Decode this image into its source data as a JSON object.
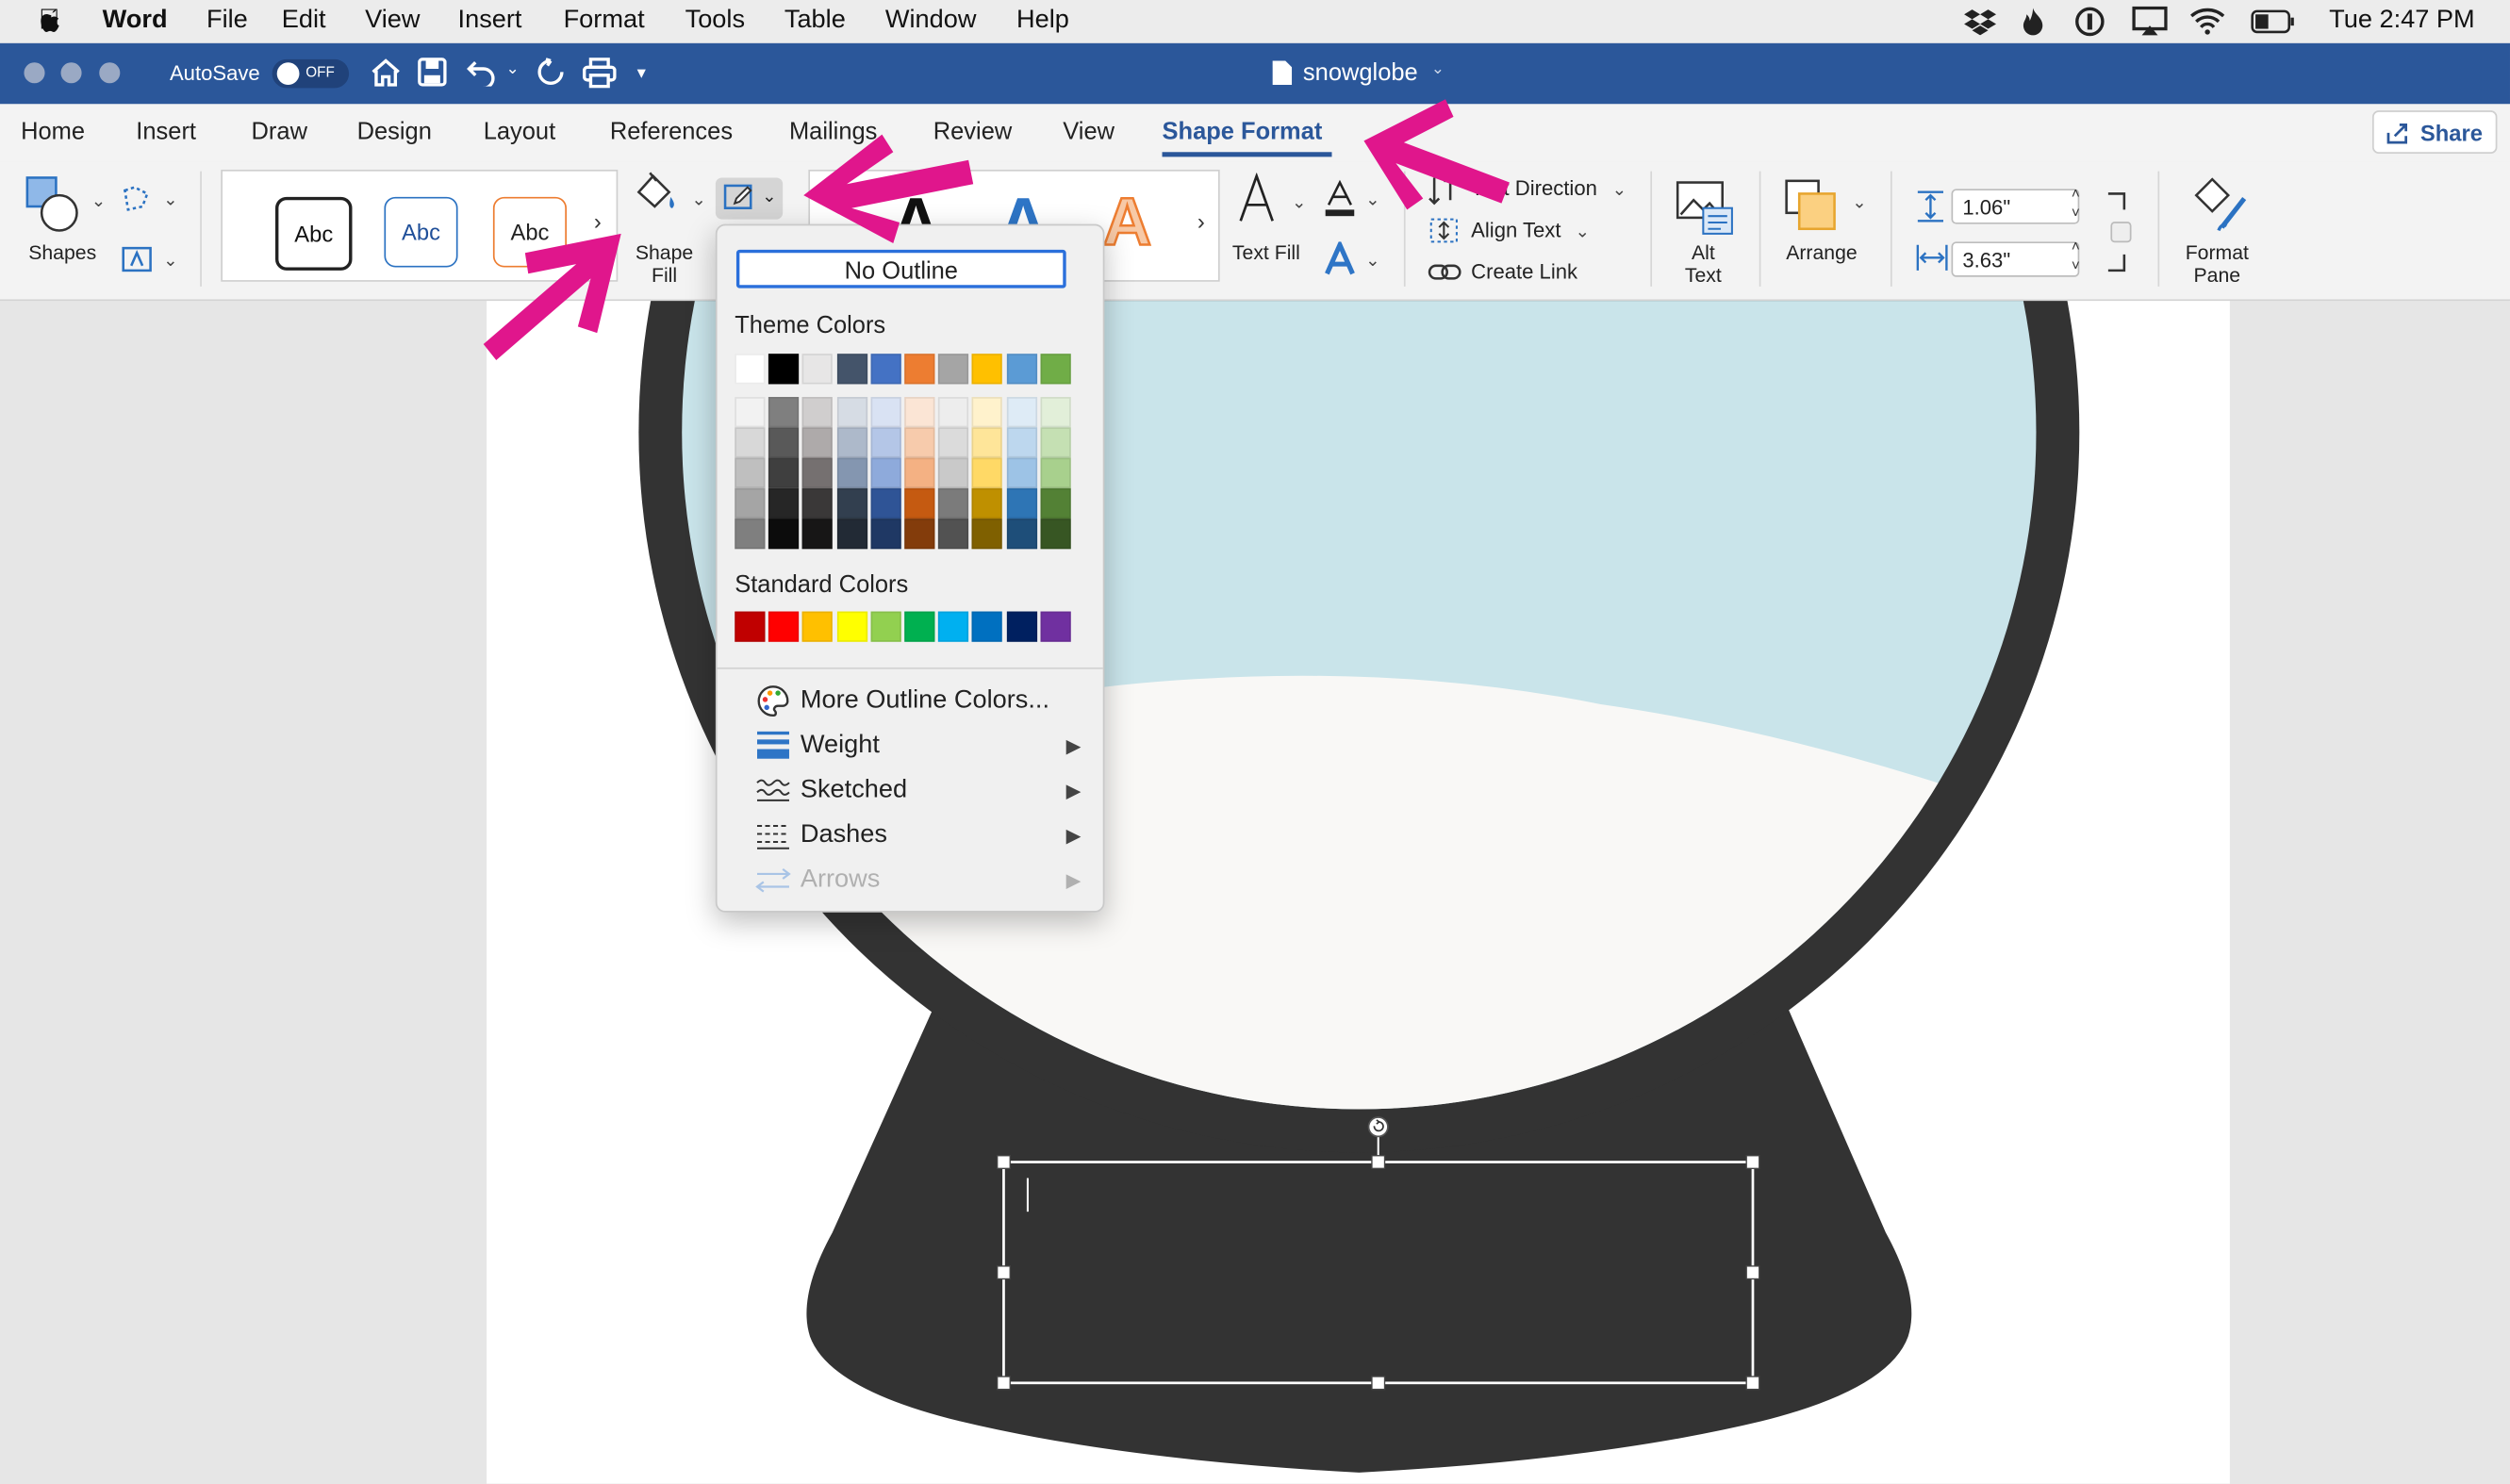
{
  "menubar": {
    "app": "Word",
    "items": [
      "File",
      "Edit",
      "View",
      "Insert",
      "Format",
      "Tools",
      "Table",
      "Window",
      "Help"
    ],
    "clock": "Tue 2:47 PM"
  },
  "titlebar": {
    "autosave_label": "AutoSave",
    "autosave_state": "OFF",
    "doc_title": "snowglobe"
  },
  "tabs": [
    "Home",
    "Insert",
    "Draw",
    "Design",
    "Layout",
    "References",
    "Mailings",
    "Review",
    "View",
    "Shape Format"
  ],
  "active_tab": "Shape Format",
  "share_label": "Share",
  "ribbon": {
    "shapes_label": "Shapes",
    "style_abc": [
      "Abc",
      "Abc",
      "Abc"
    ],
    "shape_fill_label": "Shape\nFill",
    "wordart_letters": [
      "A",
      "A",
      "A"
    ],
    "text_fill_label": "Text Fill",
    "text_direction": "Text Direction",
    "align_text": "Align Text",
    "create_link": "Create Link",
    "alt_text_label": "Alt\nText",
    "arrange_label": "Arrange",
    "height_value": "1.06\"",
    "width_value": "3.63\"",
    "format_pane_label": "Format\nPane"
  },
  "outline_menu": {
    "no_outline": "No Outline",
    "theme_colors_label": "Theme Colors",
    "theme_top": [
      "#ffffff",
      "#000000",
      "#e7e6e6",
      "#44546a",
      "#4472c4",
      "#ed7d31",
      "#a5a5a5",
      "#ffc000",
      "#5b9bd5",
      "#70ad47"
    ],
    "theme_shades": [
      [
        "#f2f2f2",
        "#7f7f7f",
        "#d0cece",
        "#d6dce4",
        "#d9e2f3",
        "#fbe5d5",
        "#ededed",
        "#fff2cc",
        "#deebf6",
        "#e2efd9"
      ],
      [
        "#d8d8d8",
        "#595959",
        "#aeaaaa",
        "#adb9ca",
        "#b4c6e7",
        "#f7cbac",
        "#dbdbdb",
        "#fee599",
        "#bdd7ee",
        "#c5e0b3"
      ],
      [
        "#bfbfbf",
        "#3f3f3f",
        "#757070",
        "#8496b0",
        "#8eaadb",
        "#f4b183",
        "#c9c9c9",
        "#ffd966",
        "#9dc3e6",
        "#a8d08d"
      ],
      [
        "#a5a5a5",
        "#262626",
        "#3a3838",
        "#323f4f",
        "#2f5496",
        "#c55a11",
        "#7b7b7b",
        "#bf9000",
        "#2e75b5",
        "#538135"
      ],
      [
        "#7f7f7f",
        "#0c0c0c",
        "#171616",
        "#222a35",
        "#1f3864",
        "#833c0b",
        "#525252",
        "#7f6000",
        "#1e4e79",
        "#375623"
      ]
    ],
    "standard_colors_label": "Standard Colors",
    "standard": [
      "#c00000",
      "#ff0000",
      "#ffc000",
      "#ffff00",
      "#92d050",
      "#00b050",
      "#00b0f0",
      "#0070c0",
      "#002060",
      "#7030a0"
    ],
    "items": [
      {
        "label": "More Outline Colors...",
        "icon": "palette-icon",
        "submenu": false,
        "disabled": false
      },
      {
        "label": "Weight",
        "icon": "line-weight-icon",
        "submenu": true,
        "disabled": false
      },
      {
        "label": "Sketched",
        "icon": "sketched-line-icon",
        "submenu": true,
        "disabled": false
      },
      {
        "label": "Dashes",
        "icon": "dashes-icon",
        "submenu": true,
        "disabled": false
      },
      {
        "label": "Arrows",
        "icon": "arrows-icon",
        "submenu": true,
        "disabled": true
      }
    ]
  },
  "colors": {
    "accent": "#2b579a",
    "annotation": "#e0168c",
    "globe_dark": "#333333",
    "globe_sky": "#c9e4ea",
    "globe_snow": "#f9f8f6"
  }
}
